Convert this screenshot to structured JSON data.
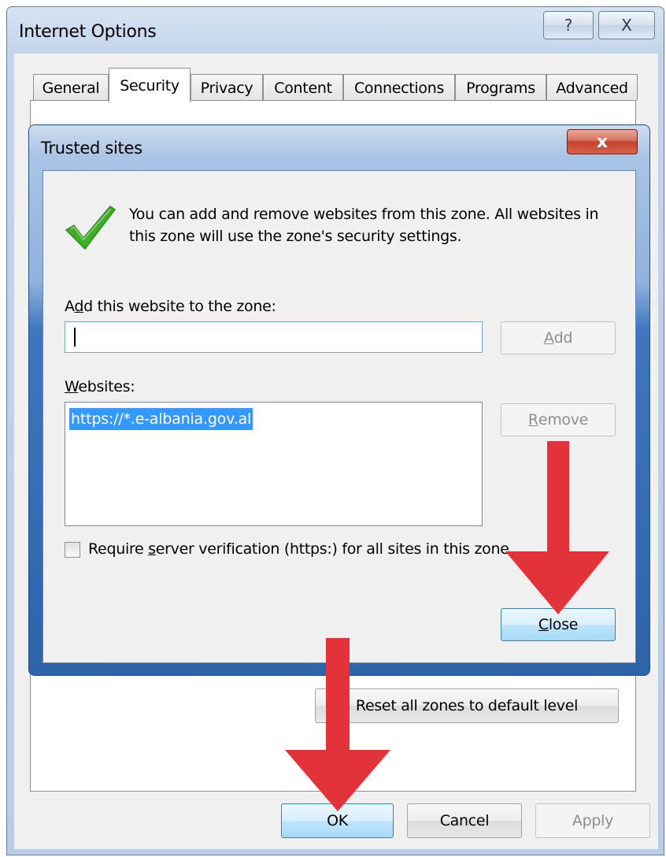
{
  "outer_window": {
    "title": "Internet Options",
    "help_glyph": "?",
    "close_glyph": "X",
    "tabs": [
      {
        "label": "General"
      },
      {
        "label": "Security"
      },
      {
        "label": "Privacy"
      },
      {
        "label": "Content"
      },
      {
        "label": "Connections"
      },
      {
        "label": "Programs"
      },
      {
        "label": "Advanced"
      }
    ],
    "active_tab": "Security",
    "reset_label": "Reset all zones to default level",
    "ok_label": "OK",
    "cancel_label": "Cancel",
    "apply_label": "Apply"
  },
  "trusted_dialog": {
    "title": "Trusted sites",
    "close_glyph": "x",
    "info_text": "You can add and remove websites from this zone. All websites in this zone will use the zone's security settings.",
    "add_label_pre": "A",
    "add_label_key": "d",
    "add_label_post": "d this website to the zone:",
    "add_input_value": "",
    "add_button_key": "A",
    "add_button_rest": "dd",
    "websites_label_key": "W",
    "websites_label_rest": "ebsites:",
    "websites": [
      "https://*.e-albania.gov.al"
    ],
    "remove_button_key": "R",
    "remove_button_rest": "emove",
    "require_pre": "Require ",
    "require_key": "s",
    "require_post": "erver verification (https:) for all sites in this zone",
    "require_checked": false,
    "close_button_key": "C",
    "close_button_rest": "lose"
  },
  "icons": {
    "checkmark": "green-checkmark-icon",
    "arrows": "red-down-arrow-icon"
  },
  "colors": {
    "selection": "#3399ff",
    "arrow_red": "#e2333b",
    "checkmark_green": "#3fae2a"
  }
}
